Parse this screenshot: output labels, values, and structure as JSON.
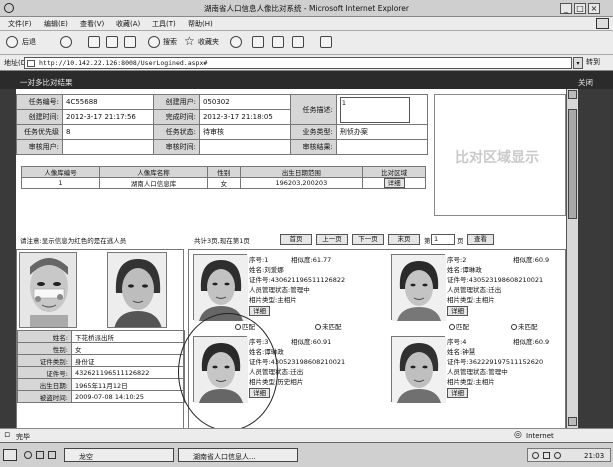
{
  "window": {
    "title": "湖南省人口信息人像比对系统 - Microsoft Internet Explorer"
  },
  "menu": [
    "文件(F)",
    "编辑(E)",
    "查看(V)",
    "收藏(A)",
    "工具(T)",
    "帮助(H)"
  ],
  "toolbar": {
    "back": "后退",
    "search": "搜索",
    "favorites": "收藏夹"
  },
  "address": {
    "label": "地址(D)",
    "url": "http://10.142.22.126:8008/UserLogined.aspx#",
    "go": "转到"
  },
  "page": {
    "title": "一对多比对结果",
    "close": "关闭"
  },
  "task": {
    "labels": {
      "task_no": "任务编号:",
      "creator": "创建用户:",
      "desc": "任务描述:",
      "created": "创建时间:",
      "finished": "完成时间:",
      "priority": "任务优先级",
      "status": "任务状态:",
      "biz_type": "业务类型:",
      "reviewer": "审核用户:",
      "review_time": "审核时间:",
      "review_result": "审核结果:"
    },
    "task_no": "4C55688",
    "creator": "050302",
    "desc": "1",
    "created": "2012-3-17 21:17:56",
    "finished": "2012-3-17 21:18:05",
    "priority": "8",
    "status": "待审核",
    "biz_type": "刑侦办案",
    "reviewer": "",
    "review_time": "",
    "review_result": ""
  },
  "db_table": {
    "headers": [
      "人像库编号",
      "人像库名称",
      "性别",
      "出生日期范围",
      "比对区域"
    ],
    "row": [
      "1",
      "湖南人口信息库",
      "女",
      "196203,200203"
    ],
    "detail_btn": "详细"
  },
  "compare_area": "比对区域显示",
  "hint": "请注意:显示信息为红色的是在逃人员",
  "pager": {
    "text": "共计3页,现在第1页",
    "first": "首页",
    "prev": "上一页",
    "next": "下一页",
    "last": "末页",
    "goto_prefix": "第",
    "goto_value": "1",
    "goto_suffix": "页",
    "view": "查看"
  },
  "query_person": {
    "labels": {
      "name": "姓名:",
      "gender": "性别:",
      "id_type": "证件类别:",
      "id_no": "证件号:",
      "birth": "出生日期:",
      "lost_time": "被盗时间:"
    },
    "name": "下花桥派出所",
    "gender": "女",
    "id_type": "身份证",
    "id_no": "432621196511126822",
    "birth": "1965年11月12日",
    "lost_time": "2009-07-08 14:10:25"
  },
  "candidates": [
    {
      "seq": "序号:1",
      "sim": "相似度:61.77",
      "name": "姓名:刘爱娜",
      "id": "证件号:430621196511126822",
      "status": "人员管理状态:管理中",
      "rel": "相片类型:主相片"
    },
    {
      "seq": "序号:2",
      "sim": "相似度:60.9",
      "name": "姓名:谭琳政",
      "id": "证件号:430523198608210021",
      "status": "人员管理状态:迁出",
      "rel": "相片类型:主相片"
    },
    {
      "seq": "序号:3",
      "sim": "相似度:60.91",
      "name": "姓名:谭琳政",
      "id": "证件号:430523198608210021",
      "status": "人员管理状态:迁出",
      "rel": "相片类型:历史相片"
    },
    {
      "seq": "序号:4",
      "sim": "相似度:60.9",
      "name": "姓名:钟慧",
      "id": "证件号:362229197511152620",
      "status": "人员管理状态:管理中",
      "rel": "相片类型:主相片"
    }
  ],
  "cand_ui": {
    "detail": "详细",
    "match": "匹配",
    "nomatch": "未匹配"
  },
  "status": {
    "left": "完毕",
    "zone": "Internet"
  },
  "taskbar": {
    "item1": "龙空",
    "item2": "湖南省人口信息人...",
    "clock": "21:03"
  }
}
